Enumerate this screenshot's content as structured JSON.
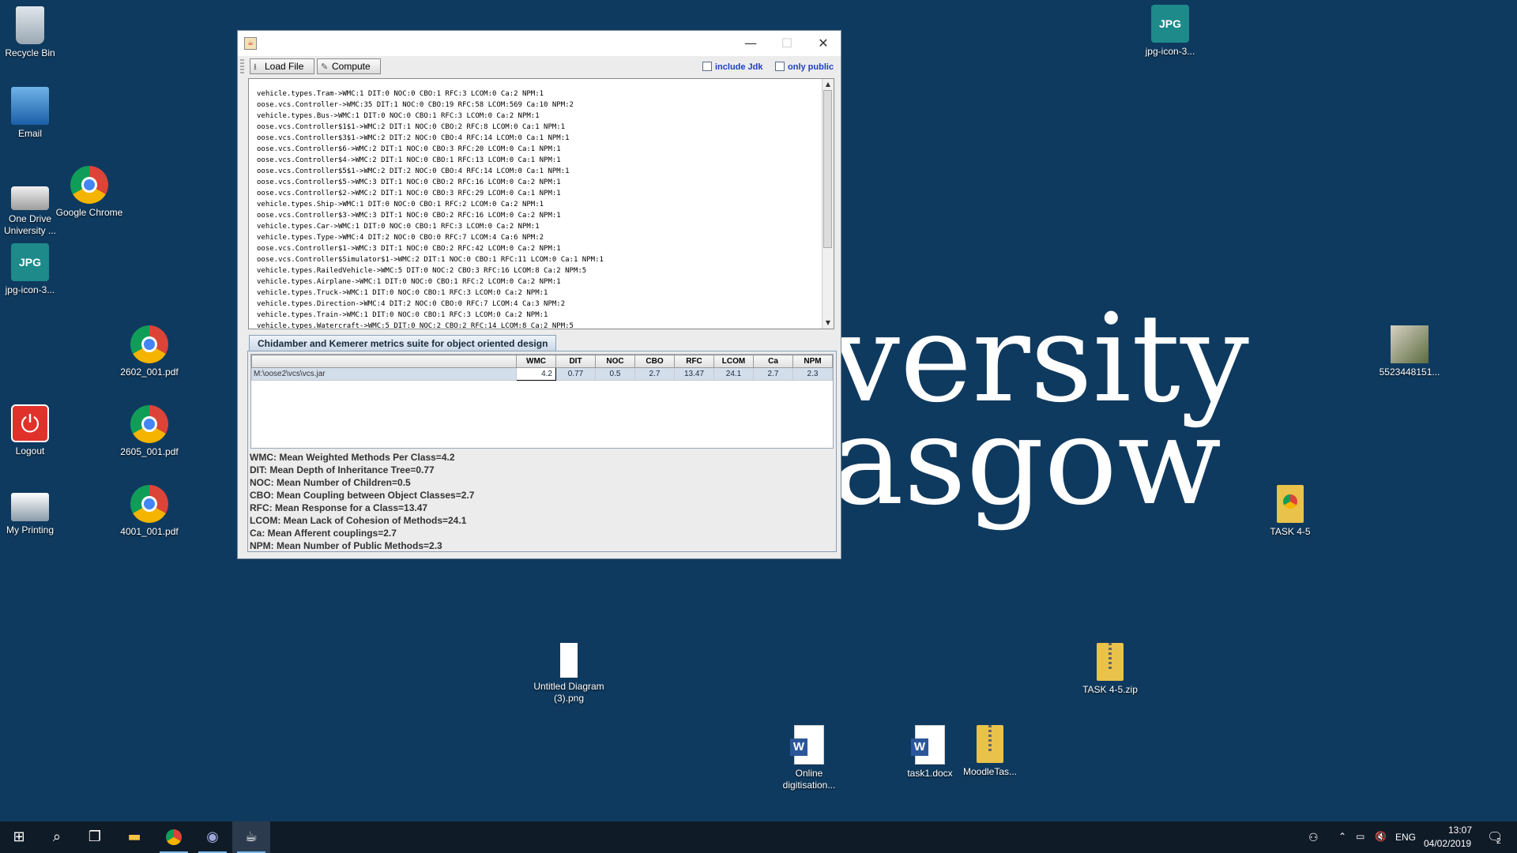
{
  "wallpaper": {
    "line1": "versity",
    "line2": "asgow"
  },
  "desktop_icons": {
    "recycle": "Recycle Bin",
    "email": "Email",
    "onedrive": "One Drive University ...",
    "chrome": "Google Chrome",
    "jpg_left": "jpg-icon-3...",
    "pdf1": "2602_001.pdf",
    "pdf2": "2605_001.pdf",
    "pdf3": "4001_001.pdf",
    "logout": "Logout",
    "printing": "My Printing",
    "jpg_right": "jpg-icon-3...",
    "photo": "5523448151...",
    "task45": "TASK 4-5",
    "task45zip": "TASK 4-5.zip",
    "untitled": "Untitled Diagram (3).png",
    "online": "Online digitisation...",
    "task1": "task1.docx",
    "moodle": "MoodleTas...",
    "jpg_glyph": "JPG"
  },
  "window": {
    "minimize": "—",
    "maximize": "☐",
    "close": "✕",
    "toolbar": {
      "load_label": "Load File",
      "compute_label": "Compute",
      "include_jdk": "include Jdk",
      "only_public": "only public"
    },
    "output_lines": [
      "vehicle.types.Tram->WMC:1 DIT:0 NOC:0 CBO:1 RFC:3 LCOM:0 Ca:2 NPM:1",
      "oose.vcs.Controller->WMC:35 DIT:1 NOC:0 CBO:19 RFC:58 LCOM:569 Ca:10 NPM:2",
      "vehicle.types.Bus->WMC:1 DIT:0 NOC:0 CBO:1 RFC:3 LCOM:0 Ca:2 NPM:1",
      "oose.vcs.Controller$1$1->WMC:2 DIT:1 NOC:0 CBO:2 RFC:8 LCOM:0 Ca:1 NPM:1",
      "oose.vcs.Controller$3$1->WMC:2 DIT:2 NOC:0 CBO:4 RFC:14 LCOM:0 Ca:1 NPM:1",
      "oose.vcs.Controller$6->WMC:2 DIT:1 NOC:0 CBO:3 RFC:20 LCOM:0 Ca:1 NPM:1",
      "oose.vcs.Controller$4->WMC:2 DIT:1 NOC:0 CBO:1 RFC:13 LCOM:0 Ca:1 NPM:1",
      "oose.vcs.Controller$5$1->WMC:2 DIT:2 NOC:0 CBO:4 RFC:14 LCOM:0 Ca:1 NPM:1",
      "oose.vcs.Controller$5->WMC:3 DIT:1 NOC:0 CBO:2 RFC:16 LCOM:0 Ca:2 NPM:1",
      "oose.vcs.Controller$2->WMC:2 DIT:1 NOC:0 CBO:3 RFC:29 LCOM:0 Ca:1 NPM:1",
      "vehicle.types.Ship->WMC:1 DIT:0 NOC:0 CBO:1 RFC:2 LCOM:0 Ca:2 NPM:1",
      "oose.vcs.Controller$3->WMC:3 DIT:1 NOC:0 CBO:2 RFC:16 LCOM:0 Ca:2 NPM:1",
      "vehicle.types.Car->WMC:1 DIT:0 NOC:0 CBO:1 RFC:3 LCOM:0 Ca:2 NPM:1",
      "vehicle.types.Type->WMC:4 DIT:2 NOC:0 CBO:0 RFC:7 LCOM:4 Ca:6 NPM:2",
      "oose.vcs.Controller$1->WMC:3 DIT:1 NOC:0 CBO:2 RFC:42 LCOM:0 Ca:2 NPM:1",
      "oose.vcs.Controller$Simulator$1->WMC:2 DIT:1 NOC:0 CBO:1 RFC:11 LCOM:0 Ca:1 NPM:1",
      "vehicle.types.RailedVehicle->WMC:5 DIT:0 NOC:2 CBO:3 RFC:16 LCOM:8 Ca:2 NPM:5",
      "vehicle.types.Airplane->WMC:1 DIT:0 NOC:0 CBO:1 RFC:2 LCOM:0 Ca:2 NPM:1",
      "vehicle.types.Truck->WMC:1 DIT:0 NOC:0 CBO:1 RFC:3 LCOM:0 Ca:2 NPM:1",
      "vehicle.types.Direction->WMC:4 DIT:2 NOC:0 CBO:0 RFC:7 LCOM:4 Ca:3 NPM:2",
      "vehicle.types.Train->WMC:1 DIT:0 NOC:0 CBO:1 RFC:3 LCOM:0 Ca:2 NPM:1",
      "vehicle.types.Watercraft->WMC:5 DIT:0 NOC:2 CBO:2 RFC:14 LCOM:8 Ca:2 NPM:5"
    ],
    "tab_title": "Chidamber and Kemerer metrics suite for object oriented design",
    "table": {
      "columns": [
        "WMC",
        "DIT",
        "NOC",
        "CBO",
        "RFC",
        "LCOM",
        "Ca",
        "NPM"
      ],
      "row": {
        "path": "M:\\oose2\\vcs\\vcs.jar",
        "values": [
          "4.2",
          "0.77",
          "0.5",
          "2.7",
          "13.47",
          "24.1",
          "2.7",
          "2.3"
        ]
      }
    },
    "summary": [
      "WMC: Mean Weighted Methods Per Class=4.2",
      "DIT: Mean Depth of Inheritance Tree=0.77",
      "NOC: Mean Number of Children=0.5",
      "CBO: Mean Coupling between Object Classes=2.7",
      "RFC: Mean Response for a Class=13.47",
      "LCOM: Mean Lack of Cohesion of Methods=24.1",
      "Ca: Mean Afferent couplings=2.7",
      "NPM: Mean Number of Public Methods=2.3"
    ]
  },
  "taskbar": {
    "language": "ENG",
    "time": "13:07",
    "date": "04/02/2019",
    "notifications": "2"
  }
}
